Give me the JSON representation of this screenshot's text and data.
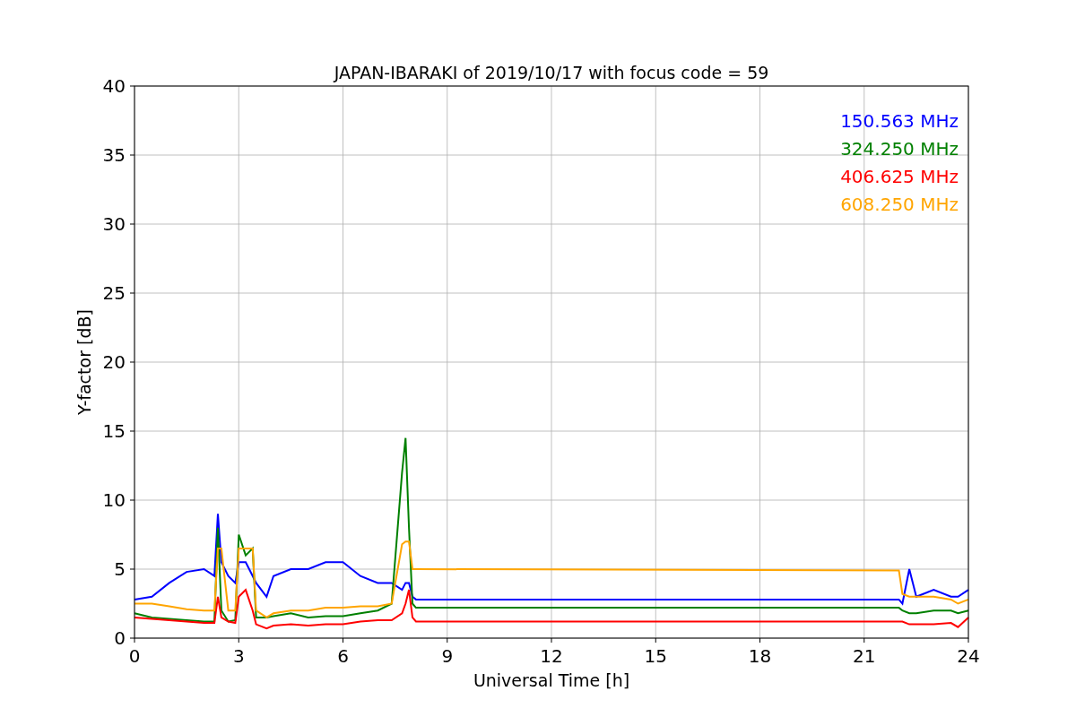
{
  "chart_data": {
    "type": "line",
    "title": "JAPAN-IBARAKI of 2019/10/17 with focus code = 59",
    "xlabel": "Universal Time [h]",
    "ylabel": "Y-factor [dB]",
    "x": [
      0,
      0.5,
      1,
      1.5,
      2,
      2.3,
      2.4,
      2.5,
      2.7,
      2.9,
      3.0,
      3.2,
      3.4,
      3.5,
      3.8,
      4,
      4.5,
      5,
      5.5,
      6,
      6.5,
      7,
      7.4,
      7.7,
      7.8,
      7.9,
      8,
      8.1,
      22,
      22.1,
      22.3,
      22.5,
      23,
      23.5,
      23.7,
      24
    ],
    "series": [
      {
        "name": "150.563 MHz",
        "color": "#0000ff",
        "values": [
          2.8,
          3.0,
          4.0,
          4.8,
          5.0,
          4.5,
          9.0,
          5.5,
          4.5,
          4.0,
          5.5,
          5.5,
          4.5,
          4.0,
          3.0,
          4.5,
          5.0,
          5.0,
          5.5,
          5.5,
          4.5,
          4.0,
          4.0,
          3.5,
          4.0,
          4.0,
          3.0,
          2.8,
          2.8,
          2.5,
          5.0,
          3.0,
          3.5,
          3.0,
          3.0,
          3.5
        ]
      },
      {
        "name": "324.250 MHz",
        "color": "#008000",
        "values": [
          1.8,
          1.5,
          1.4,
          1.3,
          1.2,
          1.2,
          8.0,
          2.0,
          1.2,
          1.3,
          7.5,
          6.0,
          6.5,
          1.5,
          1.5,
          1.6,
          1.8,
          1.5,
          1.6,
          1.6,
          1.8,
          2.0,
          2.5,
          12.0,
          14.5,
          8.0,
          2.5,
          2.2,
          2.2,
          2.0,
          1.8,
          1.8,
          2.0,
          2.0,
          1.8,
          2.0
        ]
      },
      {
        "name": "406.625 MHz",
        "color": "#ff0000",
        "values": [
          1.5,
          1.4,
          1.3,
          1.2,
          1.1,
          1.1,
          3.0,
          1.5,
          1.2,
          1.1,
          3.0,
          3.5,
          2.0,
          1.0,
          0.7,
          0.9,
          1.0,
          0.9,
          1.0,
          1.0,
          1.2,
          1.3,
          1.3,
          1.8,
          2.5,
          3.5,
          1.5,
          1.2,
          1.2,
          1.2,
          1.0,
          1.0,
          1.0,
          1.1,
          0.8,
          1.5
        ]
      },
      {
        "name": "608.250 MHz",
        "color": "#ffa500",
        "values": [
          2.5,
          2.5,
          2.3,
          2.1,
          2.0,
          2.0,
          6.5,
          6.5,
          2.0,
          2.0,
          6.5,
          6.5,
          6.5,
          2.0,
          1.5,
          1.8,
          2.0,
          2.0,
          2.2,
          2.2,
          2.3,
          2.3,
          2.5,
          6.8,
          7.0,
          7.0,
          5.0,
          5.0,
          4.9,
          3.2,
          3.0,
          3.0,
          3.0,
          2.8,
          2.5,
          2.8
        ]
      }
    ],
    "xlim": [
      0,
      24
    ],
    "ylim": [
      0,
      40
    ],
    "xticks": [
      0,
      3,
      6,
      9,
      12,
      15,
      18,
      21,
      24
    ],
    "yticks": [
      0,
      5,
      10,
      15,
      20,
      25,
      30,
      35,
      40
    ],
    "grid": true
  }
}
